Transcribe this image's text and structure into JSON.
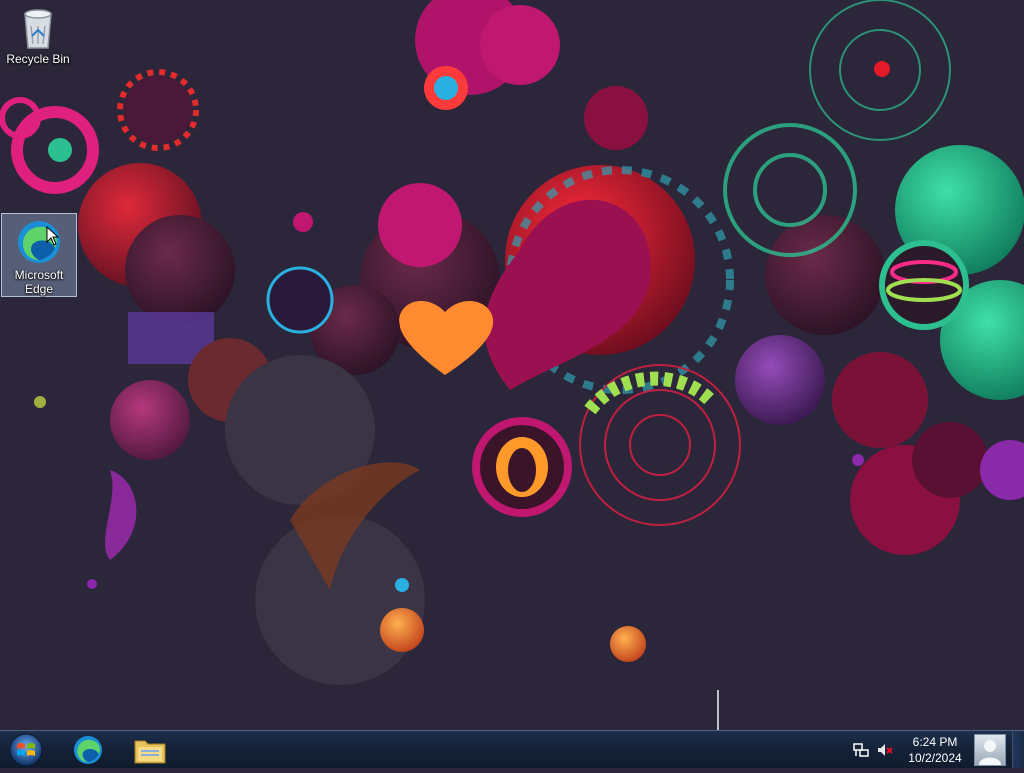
{
  "desktop": {
    "icons": [
      {
        "label": "Recycle Bin",
        "icon": "recycle-bin-icon"
      },
      {
        "label": "Microsoft Edge",
        "icon": "edge-icon",
        "selected": true
      }
    ],
    "wallpaper": "abstract colorful swirls and orbs"
  },
  "taskbar": {
    "start": {
      "icon": "windows-start-icon"
    },
    "pinned": [
      {
        "name": "Microsoft Edge",
        "icon": "edge-icon"
      },
      {
        "name": "File Explorer",
        "icon": "folder-icon"
      }
    ],
    "tray": {
      "icons": [
        "network-icon",
        "volume-muted-icon"
      ],
      "time": "6:24 PM",
      "date": "10/2/2024"
    }
  },
  "colors": {
    "wallpaper_bg": "#2b2639",
    "taskbar": "#152238",
    "accent_pink": "#e0207e",
    "accent_green": "#2dbf8f"
  }
}
